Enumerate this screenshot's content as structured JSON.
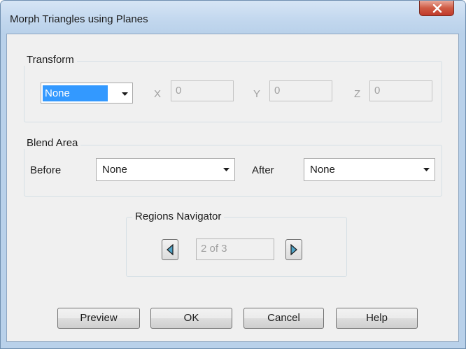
{
  "window": {
    "title": "Morph Triangles using Planes",
    "close_glyph": "X"
  },
  "transform": {
    "group_label": "Transform",
    "mode": "None",
    "x_label": "X",
    "x_value": "0",
    "y_label": "Y",
    "y_value": "0",
    "z_label": "Z",
    "z_value": "0"
  },
  "blend_area": {
    "group_label": "Blend Area",
    "before_label": "Before",
    "before_value": "None",
    "after_label": "After",
    "after_value": "None"
  },
  "regions_navigator": {
    "group_label": "Regions Navigator",
    "position": "2 of 3"
  },
  "buttons": {
    "preview": "Preview",
    "ok": "OK",
    "cancel": "Cancel",
    "help": "Help"
  },
  "icons": {
    "close": "close-icon",
    "dropdown": "chevron-down-icon",
    "prev": "triangle-left-icon",
    "next": "triangle-right-icon"
  },
  "colors": {
    "selection": "#3399ff",
    "close_button": "#c0392b",
    "nav_arrow": "#4fa3c7"
  }
}
